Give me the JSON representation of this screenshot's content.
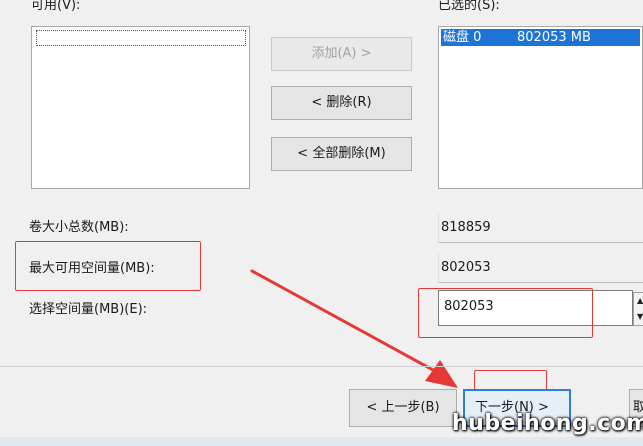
{
  "labels": {
    "available": "可用(V):",
    "selected": "已选的(S):",
    "total_size": "卷大小总数(MB):",
    "max_space": "最大可用空间量(MB):",
    "select_space": "选择空间量(MB)(E):"
  },
  "buttons": {
    "add": "添加(A) >",
    "remove": "< 删除(R)",
    "remove_all": "< 全部删除(M)",
    "back": "< 上一步(B)",
    "next": "下一步(N) >",
    "cancel": "取"
  },
  "selected_list": [
    {
      "name": "磁盘 0",
      "size": "802053 MB"
    }
  ],
  "fields": {
    "total_size": "818859",
    "max_space": "802053",
    "select_space": "802053"
  },
  "annotations": {
    "highlight_color": "#e53935",
    "arrow_color": "#e53935"
  },
  "watermark": "hubeihong.com"
}
